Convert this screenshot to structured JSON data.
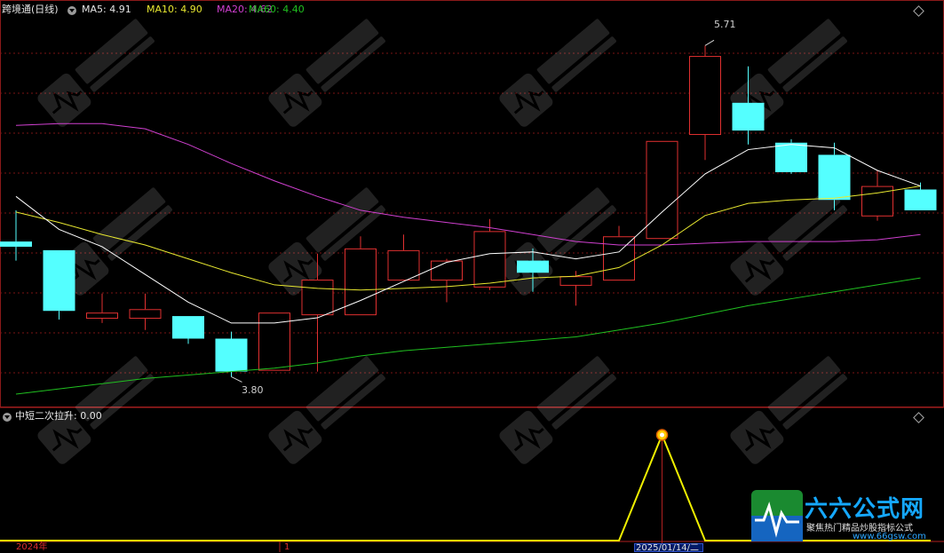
{
  "header": {
    "stock_name": "跨境通",
    "period": "(日线)",
    "ma5_label": "MA5:",
    "ma5_value": "4.91",
    "ma10_label": "MA10:",
    "ma10_value": "4.90",
    "ma20_label": "MA20:",
    "ma20_value": "4.62",
    "ma60_label": "MA60:",
    "ma60_value": "4.40"
  },
  "indicator": {
    "name": "中短二次拉升",
    "value": ": 0.00"
  },
  "price_marks": {
    "high": "5.71",
    "low": "3.80"
  },
  "bottom": {
    "year_label": "2024年",
    "month_label": "1",
    "date_label": "2025/01/14/二"
  },
  "logo": {
    "title": "六六公式网",
    "subtitle": "聚焦热门精品炒股指标公式",
    "url": "www.66gsw.com"
  },
  "colors": {
    "up": "#e03030",
    "down": "#54ffff",
    "ma5": "#ffffff",
    "ma10": "#e8e830",
    "ma20": "#d040d0",
    "ma60": "#20c020",
    "indicator": "#f0f000"
  },
  "chart_data": {
    "type": "candlestick",
    "y_range": [
      3.7,
      5.85
    ],
    "candles": [
      {
        "o": 4.58,
        "h": 4.76,
        "l": 4.47,
        "c": 4.55
      },
      {
        "o": 4.53,
        "h": 4.53,
        "l": 4.13,
        "c": 4.18
      },
      {
        "o": 4.14,
        "h": 4.28,
        "l": 4.11,
        "c": 4.17
      },
      {
        "o": 4.14,
        "h": 4.28,
        "l": 4.07,
        "c": 4.19
      },
      {
        "o": 4.15,
        "h": 4.15,
        "l": 3.99,
        "c": 4.02
      },
      {
        "o": 4.02,
        "h": 4.06,
        "l": 3.8,
        "c": 3.83
      },
      {
        "o": 3.84,
        "h": 4.17,
        "l": 3.84,
        "c": 4.17
      },
      {
        "o": 4.16,
        "h": 4.51,
        "l": 3.83,
        "c": 4.36
      },
      {
        "o": 4.16,
        "h": 4.61,
        "l": 4.16,
        "c": 4.54
      },
      {
        "o": 4.36,
        "h": 4.62,
        "l": 4.36,
        "c": 4.53
      },
      {
        "o": 4.36,
        "h": 4.48,
        "l": 4.23,
        "c": 4.47
      },
      {
        "o": 4.32,
        "h": 4.71,
        "l": 4.3,
        "c": 4.64
      },
      {
        "o": 4.47,
        "h": 4.54,
        "l": 4.29,
        "c": 4.4
      },
      {
        "o": 4.33,
        "h": 4.41,
        "l": 4.21,
        "c": 4.38
      },
      {
        "o": 4.36,
        "h": 4.67,
        "l": 4.36,
        "c": 4.61
      },
      {
        "o": 4.6,
        "h": 5.16,
        "l": 4.6,
        "c": 5.16
      },
      {
        "o": 5.2,
        "h": 5.71,
        "l": 5.05,
        "c": 5.65
      },
      {
        "o": 5.38,
        "h": 5.59,
        "l": 5.14,
        "c": 5.22
      },
      {
        "o": 5.15,
        "h": 5.17,
        "l": 4.97,
        "c": 4.98
      },
      {
        "o": 5.08,
        "h": 5.15,
        "l": 4.76,
        "c": 4.82
      },
      {
        "o": 4.73,
        "h": 4.99,
        "l": 4.7,
        "c": 4.9
      },
      {
        "o": 4.88,
        "h": 4.92,
        "l": 4.76,
        "c": 4.76
      }
    ],
    "ma5": [
      4.84,
      4.65,
      4.55,
      4.39,
      4.23,
      4.11,
      4.11,
      4.14,
      4.24,
      4.35,
      4.46,
      4.51,
      4.52,
      4.48,
      4.52,
      4.75,
      4.97,
      5.11,
      5.14,
      5.12,
      4.99,
      4.9
    ],
    "ma10": [
      4.75,
      4.69,
      4.62,
      4.56,
      4.48,
      4.4,
      4.33,
      4.31,
      4.3,
      4.31,
      4.32,
      4.34,
      4.37,
      4.38,
      4.43,
      4.56,
      4.73,
      4.8,
      4.82,
      4.83,
      4.86,
      4.9
    ],
    "ma20": [
      5.25,
      5.26,
      5.26,
      5.23,
      5.14,
      5.03,
      4.93,
      4.84,
      4.76,
      4.72,
      4.69,
      4.66,
      4.62,
      4.58,
      4.56,
      4.56,
      4.57,
      4.58,
      4.58,
      4.58,
      4.59,
      4.62
    ],
    "ma60": [
      3.7,
      3.73,
      3.76,
      3.79,
      3.81,
      3.83,
      3.85,
      3.88,
      3.92,
      3.95,
      3.97,
      3.99,
      4.01,
      4.03,
      4.07,
      4.11,
      4.16,
      4.21,
      4.25,
      4.29,
      4.33,
      4.37
    ],
    "indicator_values": [
      0,
      0,
      0,
      0,
      0,
      0,
      0,
      0,
      0,
      0,
      0,
      0,
      0,
      0,
      0,
      1,
      0,
      0,
      0,
      0,
      0,
      0
    ]
  }
}
